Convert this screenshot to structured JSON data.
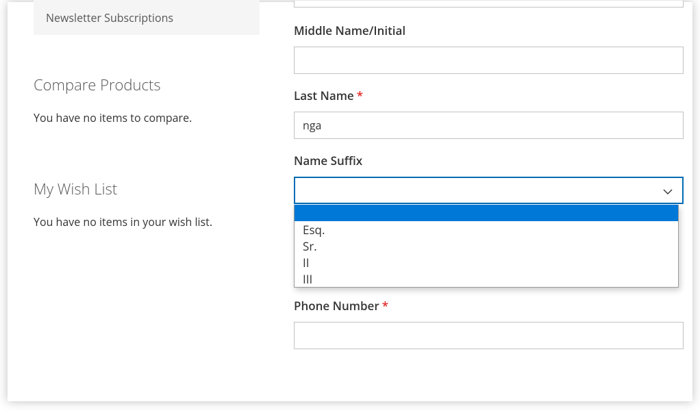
{
  "sidebar": {
    "nav": {
      "newsletter_label": "Newsletter Subscriptions"
    },
    "compare": {
      "title": "Compare Products",
      "empty_text": "You have no items to compare."
    },
    "wishlist": {
      "title": "My Wish List",
      "empty_text": "You have no items in your wish list."
    }
  },
  "form": {
    "middle_name": {
      "label": "Middle Name/Initial",
      "value": ""
    },
    "last_name": {
      "label": "Last Name",
      "value": "nga"
    },
    "name_suffix": {
      "label": "Name Suffix",
      "selected": "",
      "options": [
        "",
        "Esq.",
        "Sr.",
        "II",
        "III"
      ]
    },
    "phone_number": {
      "label": "Phone Number",
      "value": ""
    }
  }
}
